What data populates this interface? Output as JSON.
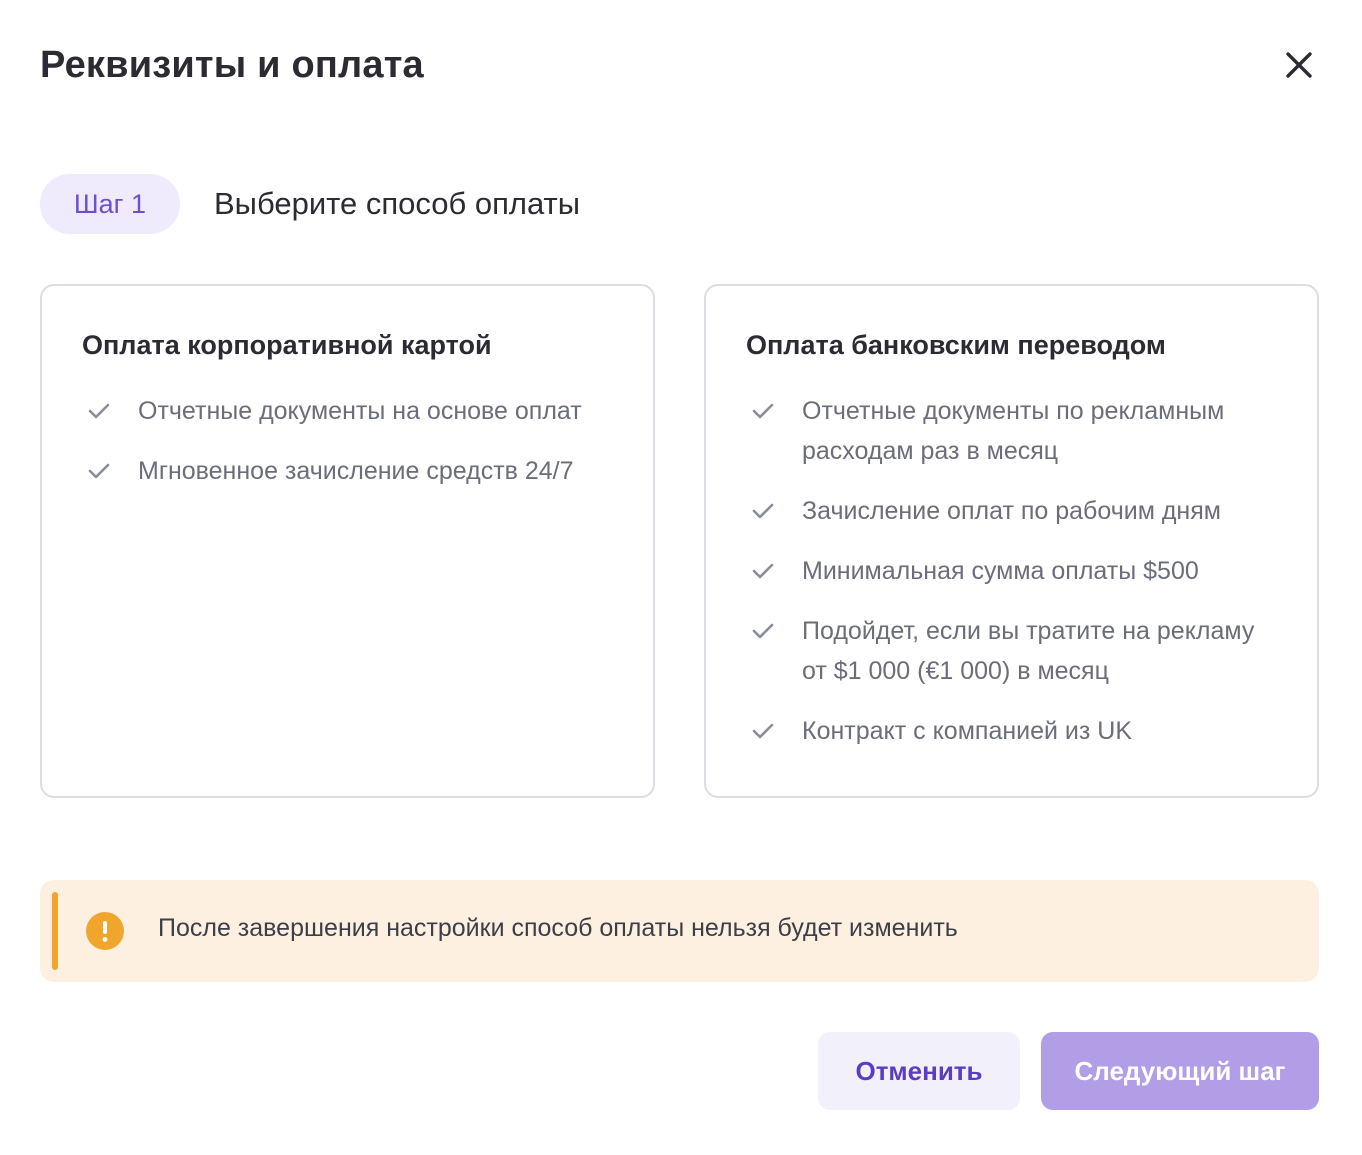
{
  "dialog": {
    "title": "Реквизиты и оплата",
    "close_icon": "close-icon"
  },
  "step": {
    "badge": "Шаг 1",
    "title": "Выберите способ оплаты"
  },
  "options": [
    {
      "title": "Оплата корпоративной картой",
      "features": [
        "Отчетные документы на основе оплат",
        "Мгновенное зачисление средств 24/7"
      ]
    },
    {
      "title": "Оплата банковским переводом",
      "features": [
        "Отчетные документы по рекламным расходам раз в месяц",
        "Зачисление оплат по рабочим дням",
        "Минимальная сумма оплаты $500",
        "Подойдет, если вы тратите на рекламу от $1 000 (€1 000) в месяц",
        "Контракт с компанией из UK"
      ]
    }
  ],
  "notice": {
    "text": "После завершения настройки способ оплаты нельзя будет изменить",
    "icon": "warning-icon"
  },
  "footer": {
    "cancel_label": "Отменить",
    "next_label": "Следующий шаг"
  },
  "colors": {
    "accent": "#6e4fd0",
    "accent_light": "#efeafc",
    "next_button": "#b19ee6",
    "warning": "#f0a52d",
    "warning_bg": "#fdf0e0",
    "check": "#8a8e9c"
  }
}
